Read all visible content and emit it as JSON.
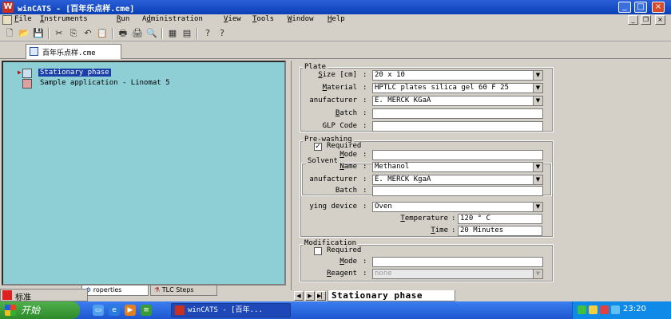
{
  "window": {
    "title": "winCATS - [百年乐点样.cme]",
    "minimize": "_",
    "maximize": "□",
    "close": "×"
  },
  "menu": {
    "items": [
      {
        "pre": "",
        "u": "F",
        "post": "ile"
      },
      {
        "pre": "",
        "u": "I",
        "post": "nstruments"
      },
      {
        "pre": "",
        "u": "R",
        "post": "un"
      },
      {
        "pre": "A",
        "u": "d",
        "post": "ministration"
      },
      {
        "pre": "",
        "u": "V",
        "post": "iew"
      },
      {
        "pre": "",
        "u": "T",
        "post": "ools"
      },
      {
        "pre": "",
        "u": "W",
        "post": "indow"
      },
      {
        "pre": "",
        "u": "H",
        "post": "elp"
      }
    ]
  },
  "toolbar": {
    "icons": [
      "new-icon",
      "open-icon",
      "save-icon",
      "sep",
      "cut-icon",
      "copy-icon",
      "undo-icon",
      "paste-icon",
      "sep",
      "print-icon",
      "print2-icon",
      "preview-icon",
      "sep",
      "calc-icon",
      "table-icon",
      "sep",
      "help-icon",
      "whatsthis-icon"
    ],
    "glyphs": [
      "🗋",
      "📂",
      "💾",
      "",
      "✂",
      "⎘",
      "↶",
      "📋",
      "",
      "🖶",
      "🖨",
      "🔍",
      "",
      "▦",
      "▤",
      "",
      "?",
      "?"
    ]
  },
  "document_tab": {
    "label": "百年乐点样.cme"
  },
  "tree": {
    "items": [
      {
        "label": "Stationary phase",
        "selected": true,
        "icon_color": "#c8e0f0"
      },
      {
        "label": "Sample application - Linomat 5",
        "selected": false,
        "icon_color": "#e0a0a0"
      }
    ]
  },
  "left_tabs": {
    "items": [
      "标准",
      "Properties",
      "TLC Steps"
    ],
    "visible_text": [
      "标准",
      "roperties",
      "TLC Steps"
    ]
  },
  "plate": {
    "legend": "Plate",
    "size": {
      "label_u": "S",
      "label": "ize [cm]",
      "value": "20 x 10"
    },
    "material": {
      "label_u": "M",
      "label": "aterial",
      "value": "HPTLC plates silica gel 60 F 25"
    },
    "manufacturer": {
      "label": "anufacturer",
      "value": "E. MERCK KGaA"
    },
    "batch": {
      "label_u": "B",
      "label": "atch",
      "value": ""
    },
    "glp": {
      "label": "GLP Code",
      "label_u": "C",
      "value": ""
    }
  },
  "prewashing": {
    "legend": "Pre-washing",
    "required": {
      "label": "Required",
      "checked": "✓"
    },
    "mode": {
      "label_u": "M",
      "label": "ode",
      "value": ""
    },
    "solvent": {
      "legend": "Solvent",
      "name": {
        "label_u": "N",
        "label": "ame",
        "value": "Methanol"
      },
      "manufacturer": {
        "label": "anufacturer",
        "value": "E. MERCK KgaA"
      },
      "batch": {
        "label": "Batch",
        "value": ""
      }
    },
    "drying_device": {
      "label": "ying device",
      "value": "Oven"
    },
    "temperature": {
      "label_u": "T",
      "label": "emperature",
      "value": "120 ° C"
    },
    "time": {
      "label_u": "T",
      "label": "ime",
      "value": "20 Minutes"
    }
  },
  "modification": {
    "legend": "Modification",
    "required": {
      "label": "Required",
      "checked": ""
    },
    "mode": {
      "label_u": "M",
      "label": "ode",
      "value": ""
    },
    "reagent": {
      "label_u": "R",
      "label": "eagent",
      "value": "none"
    }
  },
  "bottom_tab": {
    "label": "Stationary phase"
  },
  "taskbar": {
    "start": "开始",
    "task": "winCATS - [百年...",
    "clock": "23:20"
  },
  "ime": {
    "label": "标准"
  },
  "colors": {
    "tree_bg": "#8ecfd6",
    "selection": "#1a3fa8",
    "titlebar": "#0a3fb6",
    "taskbar": "#2a64e0",
    "start": "#3a9a36"
  }
}
